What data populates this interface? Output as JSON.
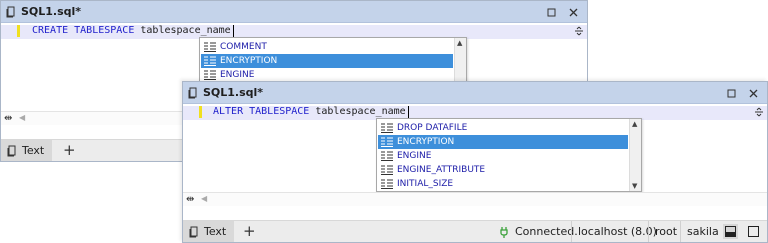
{
  "window1": {
    "title": "SQL1.sql*",
    "sql_keyword": "CREATE TABLESPACE",
    "sql_identifier": "tablespace_name",
    "suggestions": [
      "COMMENT",
      "ENCRYPTION",
      "ENGINE"
    ],
    "selected_index": 1,
    "bottom_tab_label": "Text",
    "add_tab_label": "+"
  },
  "window2": {
    "title": "SQL1.sql*",
    "sql_keyword": "ALTER TABLESPACE",
    "sql_identifier": "tablespace_name",
    "suggestions": [
      "DROP DATAFILE",
      "ENCRYPTION",
      "ENGINE",
      "ENGINE_ATTRIBUTE",
      "INITIAL_SIZE"
    ],
    "selected_index": 1,
    "bottom_tab_label": "Text",
    "add_tab_label": "+",
    "status": {
      "connection": "Connected.",
      "server": "localhost (8.0)",
      "user": "root",
      "database": "sakila"
    }
  },
  "icons": {
    "document": "document-icon",
    "restore": "restore-icon",
    "close": "close-icon",
    "splitter": "splitter-icon",
    "keyword": "keyword-list-icon",
    "plug": "plug-icon"
  },
  "colors": {
    "titlebar": "#c4d3ea",
    "selection": "#3d8fdb",
    "keyword": "#2222cc",
    "suggestion_text": "#1c1ca8",
    "current_line": "#e8e8fa",
    "connected": "#3aa13a"
  }
}
